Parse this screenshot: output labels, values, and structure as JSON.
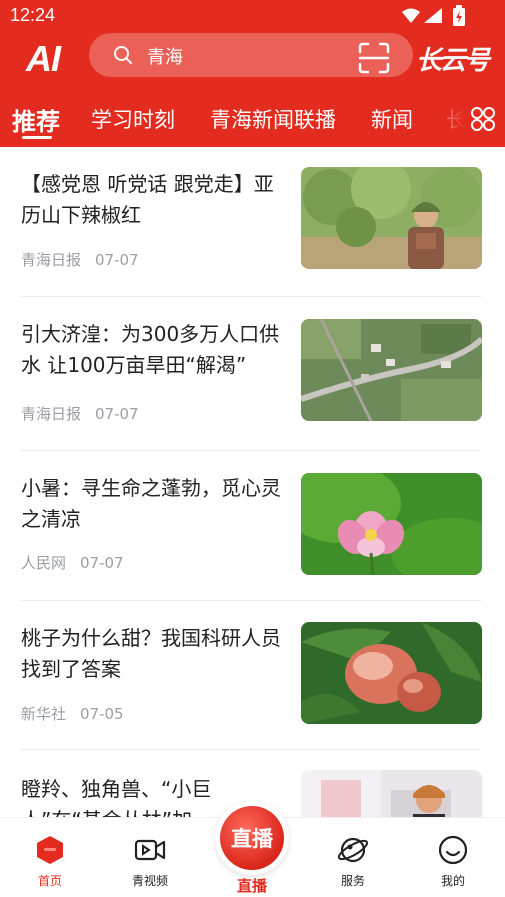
{
  "status_bar": {
    "time": "12:24"
  },
  "header": {
    "ai_label": "AI",
    "search": {
      "value": "青海"
    },
    "brand": "长云号",
    "colors": {
      "primary": "#e42b1f"
    }
  },
  "tabs": [
    {
      "label": "推荐",
      "active": true
    },
    {
      "label": "学习时刻"
    },
    {
      "label": "青海新闻联播"
    },
    {
      "label": "新闻"
    },
    {
      "label": "长"
    }
  ],
  "news": [
    {
      "title": "【感党恩 听党话 跟党走】亚历山下辣椒红",
      "source": "青海日报",
      "date": "07-07",
      "thumb": "orchard-farmer"
    },
    {
      "title": "引大济湟：为300多万人口供水 让100万亩旱田“解渴”",
      "source": "青海日报",
      "date": "07-07",
      "thumb": "aerial-village"
    },
    {
      "title": "小暑：寻生命之蓬勃，觅心灵之清凉",
      "source": "人民网",
      "date": "07-07",
      "thumb": "lotus-flower"
    },
    {
      "title": "桃子为什么甜？我国科研人员找到了答案",
      "source": "新华社",
      "date": "07-05",
      "thumb": "flat-peaches"
    },
    {
      "title": "瞪羚、独角兽、“小巨人”在“基金丛林”加",
      "source": "",
      "date": "",
      "thumb": "office-person"
    }
  ],
  "bottom_nav": [
    {
      "label": "首页",
      "icon": "home-icon",
      "active": true
    },
    {
      "label": "青视频",
      "icon": "video-icon"
    },
    {
      "label": "直播",
      "icon": "live-icon"
    },
    {
      "label": "服务",
      "icon": "planet-icon"
    },
    {
      "label": "我的",
      "icon": "smile-icon"
    }
  ],
  "live_button": {
    "badge": "直播",
    "label": "直播"
  }
}
